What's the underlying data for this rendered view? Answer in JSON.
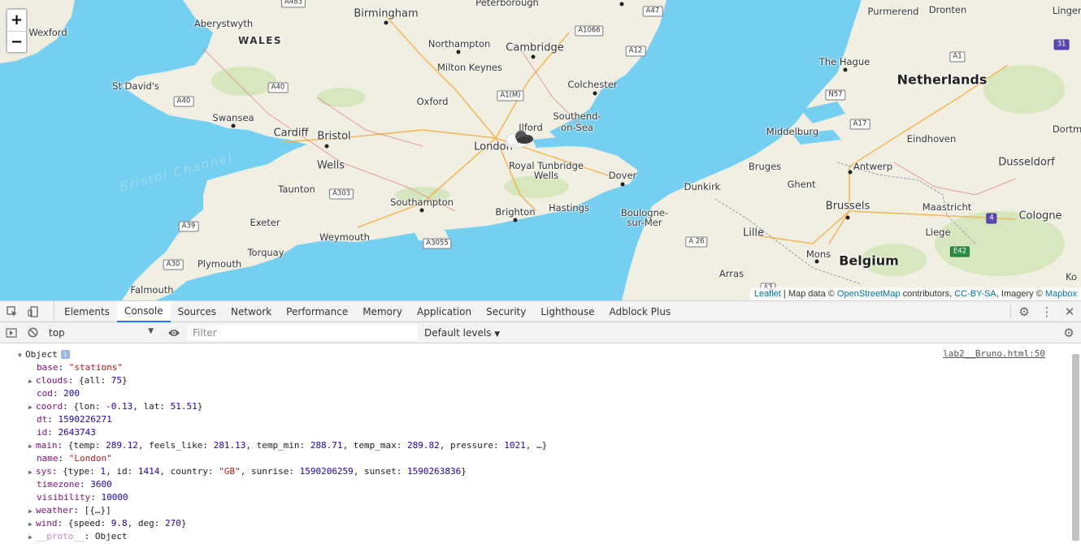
{
  "map": {
    "zoom_in": "+",
    "zoom_out": "−",
    "attribution": {
      "leaflet": "Leaflet",
      "sep1": " | Map data © ",
      "osm": "OpenStreetMap",
      "sep2": " contributors, ",
      "license": "CC-BY-SA",
      "sep3": ", Imagery © ",
      "mapbox": "Mapbox"
    },
    "labels": {
      "birmingham": "Birmingham",
      "peterborough": "Peterborough",
      "aberystwyth": "Aberystwyth",
      "wexford": "Wexford",
      "wales": "WALES",
      "northampton": "Northampton",
      "cambridge": "Cambridge",
      "milton_keynes": "Milton Keynes",
      "st_davids": "St David's",
      "colchester": "Colchester",
      "oxford": "Oxford",
      "swansea": "Swansea",
      "cardiff": "Cardiff",
      "bristol": "Bristol",
      "ilford": "Ilford",
      "southend": "Southend-",
      "on_sea": "on-Sea",
      "london": "London",
      "bristol_channel": "Bristol Channel",
      "wells": "Wells",
      "royal_tunbridge": "Royal Tunbridge",
      "wells2": "Wells",
      "dover": "Dover",
      "taunton": "Taunton",
      "southampton": "Southampton",
      "brighton": "Brighton",
      "hastings": "Hastings",
      "boulogne": "Boulogne-",
      "sur_mer": "sur-Mer",
      "exeter": "Exeter",
      "weymouth": "Weymouth",
      "torquay": "Torquay",
      "plymouth": "Plymouth",
      "falmouth": "Falmouth",
      "purmerend": "Purmerend",
      "dronten": "Dronten",
      "lingen": "Lingen",
      "the_hague": "The Hague",
      "netherlands": "Netherlands",
      "middelburg": "Middelburg",
      "eindhoven": "Eindhoven",
      "dortm": "Dortm",
      "bruges": "Bruges",
      "antwerp": "Antwerp",
      "dusseldorf": "Dusseldorf",
      "dunkirk": "Dunkirk",
      "ghent": "Ghent",
      "brussels": "Brussels",
      "maastricht": "Maastricht",
      "cologne": "Cologne",
      "lille": "Lille",
      "liege": "Liege",
      "mons": "Mons",
      "belgium": "Belgium",
      "arras": "Arras",
      "ko": "Ko"
    },
    "roads": {
      "a483": "A483",
      "a47": "A47",
      "a1066": "A1066",
      "a12": "A12",
      "a40": "A40",
      "a40b": "A40",
      "a1m": "A1(M)",
      "a303": "A303",
      "a39": "A39",
      "a30": "A30",
      "a3055": "A3055",
      "a1": "A1",
      "n57": "N57",
      "a17": "A17",
      "a26": "A 26",
      "e42": "E42",
      "r31": "31",
      "r4": "4",
      "a3": "A3"
    }
  },
  "devtools": {
    "tabs": [
      "Elements",
      "Console",
      "Sources",
      "Network",
      "Performance",
      "Memory",
      "Application",
      "Security",
      "Lighthouse",
      "Adblock Plus"
    ],
    "active_tab": "Console",
    "context": "top",
    "filter_placeholder": "Filter",
    "levels": "Default levels",
    "source_link": "lab2__Bruno.html:50",
    "object_label": "Object",
    "props": {
      "base_k": "base",
      "base_v": "\"stations\"",
      "clouds_k": "clouds",
      "clouds_v1": "{all: ",
      "clouds_n": "75",
      "clouds_v2": "}",
      "cod_k": "cod",
      "cod_v": "200",
      "coord_k": "coord",
      "coord_a": "{lon: ",
      "coord_lon": "-0.13",
      "coord_b": ", lat: ",
      "coord_lat": "51.51",
      "coord_c": "}",
      "dt_k": "dt",
      "dt_v": "1590226271",
      "id_k": "id",
      "id_v": "2643743",
      "main_k": "main",
      "main_a": "{temp: ",
      "main_temp": "289.12",
      "main_b": ", feels_like: ",
      "main_fl": "281.13",
      "main_c": ", temp_min: ",
      "main_min": "288.71",
      "main_d": ", temp_max: ",
      "main_max": "289.82",
      "main_e": ", pressure: ",
      "main_p": "1021",
      "main_f": ", …}",
      "name_k": "name",
      "name_v": "\"London\"",
      "sys_k": "sys",
      "sys_a": "{type: ",
      "sys_type": "1",
      "sys_b": ", id: ",
      "sys_id": "1414",
      "sys_c": ", country: ",
      "sys_country": "\"GB\"",
      "sys_d": ", sunrise: ",
      "sys_sunrise": "1590206259",
      "sys_e": ", sunset: ",
      "sys_sunset": "1590263836",
      "sys_f": "}",
      "tz_k": "timezone",
      "tz_v": "3600",
      "vis_k": "visibility",
      "vis_v": "10000",
      "weather_k": "weather",
      "weather_v": "[{…}]",
      "wind_k": "wind",
      "wind_a": "{speed: ",
      "wind_speed": "9.8",
      "wind_b": ", deg: ",
      "wind_deg": "270",
      "wind_c": "}",
      "proto_k": "__proto__",
      "proto_v": "Object"
    }
  }
}
